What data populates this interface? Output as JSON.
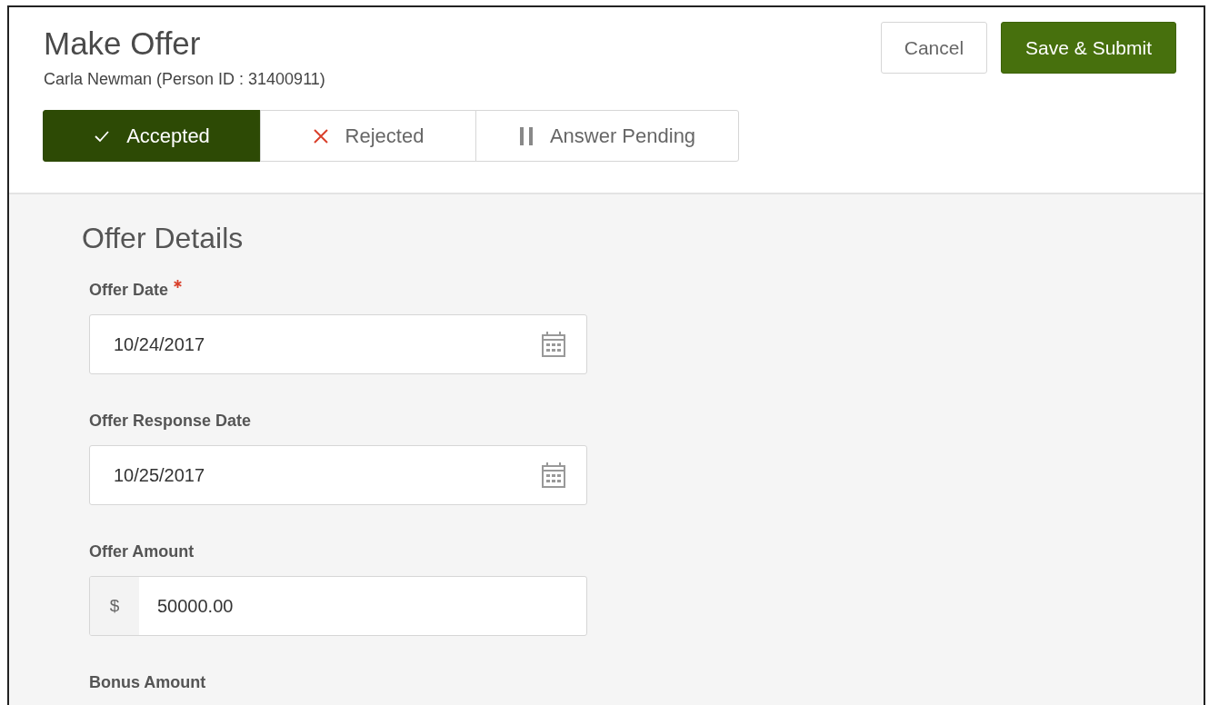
{
  "header": {
    "title": "Make Offer",
    "subtitle": "Carla Newman (Person ID : 31400911)"
  },
  "status_tabs": [
    {
      "label": "Accepted",
      "kind": "check",
      "selected": true
    },
    {
      "label": "Rejected",
      "kind": "cross",
      "selected": false
    },
    {
      "label": "Answer Pending",
      "kind": "pause",
      "selected": false
    }
  ],
  "actions": [
    {
      "label": "Cancel",
      "kind": "secondary"
    },
    {
      "label": "Save & Submit",
      "kind": "primary"
    }
  ],
  "section": {
    "title": "Offer Details"
  },
  "fields": [
    {
      "label": "Offer Date",
      "required": true,
      "kind": "date",
      "value": "10/24/2017"
    },
    {
      "label": "Offer Response Date",
      "required": false,
      "kind": "date",
      "value": "10/25/2017"
    },
    {
      "label": "Offer Amount",
      "required": false,
      "kind": "currency",
      "prefix": "$",
      "value": "50000.00"
    },
    {
      "label": "Bonus Amount",
      "required": false,
      "kind": "none"
    }
  ]
}
